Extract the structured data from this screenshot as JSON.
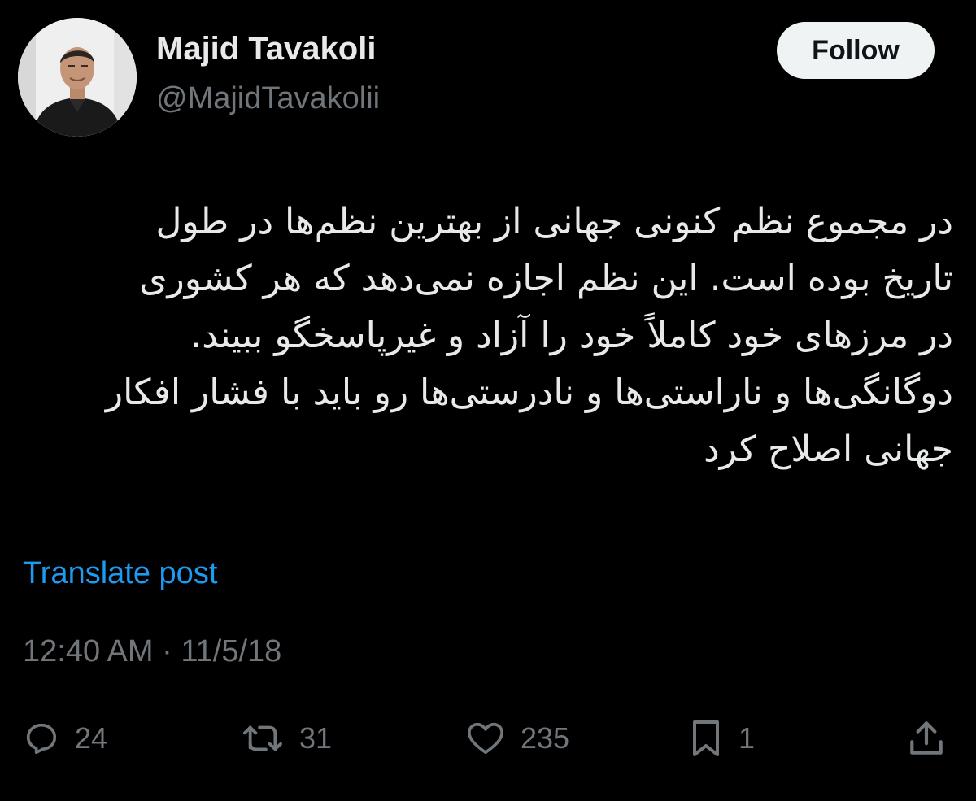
{
  "author": {
    "name": "Majid Tavakoli",
    "handle": "@MajidTavakolii"
  },
  "follow_button": {
    "label": "Follow"
  },
  "post": {
    "lines": [
      "در مجموع نظم کنونی جهانی از بهترین نظم‌ها در طول",
      "تاریخ بوده است. این نظم اجازه نمی‌دهد که هر کشوری",
      "در مرزهای خود کاملاً خود را آزاد و غیرپاسخگو ببیند.",
      "دوگانگی‌ها و ناراستی‌ها و نادرستی‌ها رو باید با فشار افکار",
      "جهانی اصلاح کرد"
    ]
  },
  "translate": {
    "label": "Translate post"
  },
  "timestamp": {
    "text": "12:40 AM · 11/5/18"
  },
  "actions": {
    "reply": {
      "icon": "reply-icon",
      "count": "24"
    },
    "repost": {
      "icon": "repost-icon",
      "count": "31"
    },
    "like": {
      "icon": "heart-icon",
      "count": "235"
    },
    "bookmark": {
      "icon": "bookmark-icon",
      "count": "1"
    },
    "share": {
      "icon": "share-icon"
    }
  },
  "colors": {
    "background": "#000000",
    "text_primary": "#e7e9ea",
    "text_secondary": "#71767b",
    "link": "#1d9bf0",
    "button_bg": "#eff3f4"
  }
}
